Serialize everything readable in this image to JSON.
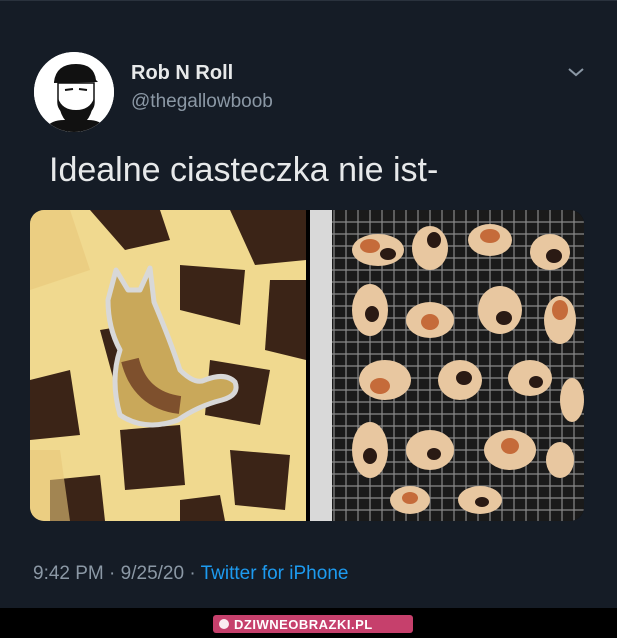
{
  "tweet": {
    "author_name": "Rob N Roll",
    "author_handle": "@thegallowboob",
    "text": "Idealne ciasteczka nie ist-",
    "time": "9:42 PM",
    "date": "9/25/20",
    "source": "Twitter for iPhone",
    "separator": "·"
  },
  "watermark": {
    "text": "DZIWNEOBRAZKI.PL"
  },
  "icons": {
    "avatar": "bearded-man-avatar",
    "menu": "chevron-down-icon"
  },
  "colors": {
    "background": "#151c26",
    "text_primary": "#e7e9ea",
    "text_secondary": "#8b98a5",
    "link": "#1d9bf0",
    "watermark_bg": "#c6406c"
  }
}
